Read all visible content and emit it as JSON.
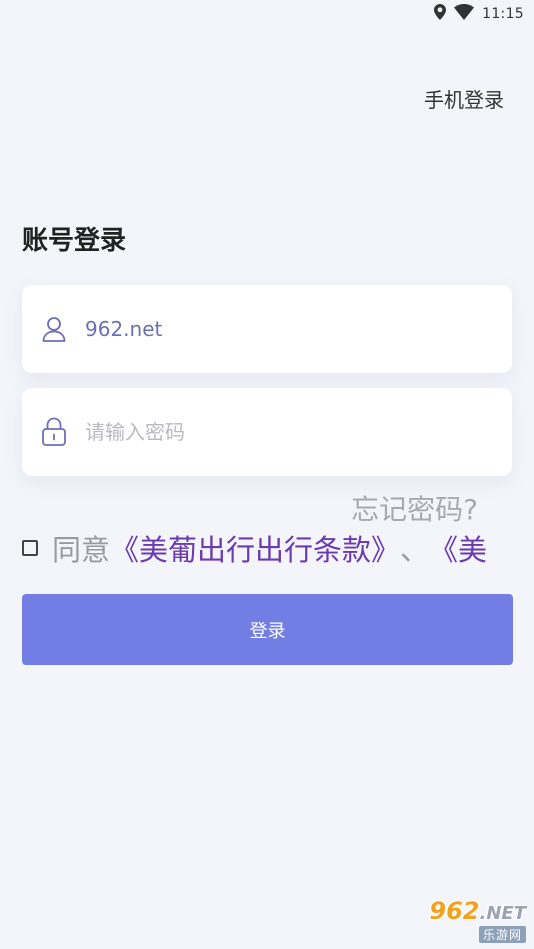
{
  "status_bar": {
    "time": "11:15",
    "icons": [
      "location-icon",
      "wifi-icon"
    ]
  },
  "header": {
    "phone_login": "手机登录"
  },
  "title": "账号登录",
  "username": {
    "value": "962.net",
    "icon": "user-icon"
  },
  "password": {
    "placeholder": "请输入密码",
    "icon": "lock-icon"
  },
  "forgot": "忘记密码?",
  "agreement": {
    "prefix": "同意",
    "terms_link": "《美葡出行出行条款》",
    "separator": "、",
    "second_link": "《美"
  },
  "login_button": "登录",
  "watermark": {
    "top": "962",
    "top_suffix": ".NET",
    "bottom": "乐游网"
  },
  "colors": {
    "accent": "#737ee5",
    "link": "#6a3bb0",
    "background": "#f4f5fa"
  }
}
